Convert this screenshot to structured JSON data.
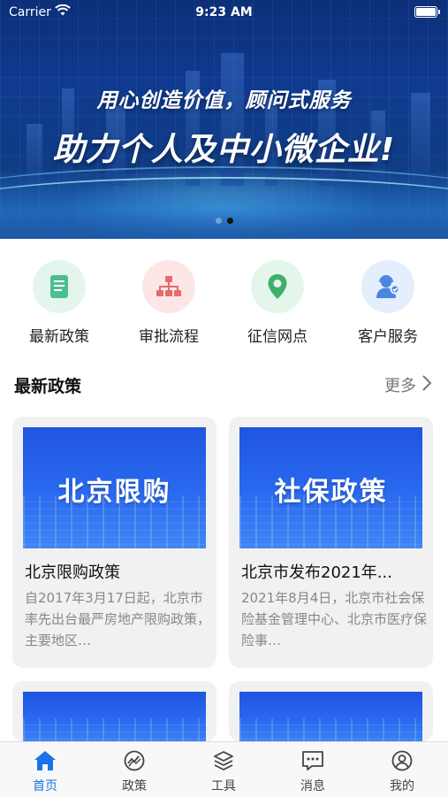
{
  "status_bar": {
    "carrier": "Carrier",
    "time": "9:23 AM"
  },
  "banner": {
    "line1": "用心创造价值，顾问式服务",
    "line2": "助力个人及中小微企业!",
    "page_count": 2,
    "active_page": 2
  },
  "quick_actions": [
    {
      "label": "最新政策",
      "icon": "document-icon",
      "bg": "#e4f5ee",
      "fg": "#4bbf8f"
    },
    {
      "label": "审批流程",
      "icon": "org-chart-icon",
      "bg": "#fde6e6",
      "fg": "#e86a6a"
    },
    {
      "label": "征信网点",
      "icon": "location-pin-icon",
      "bg": "#e4f6ea",
      "fg": "#3fb06a"
    },
    {
      "label": "客户服务",
      "icon": "customer-service-icon",
      "bg": "#e4eefc",
      "fg": "#4a86e0"
    }
  ],
  "section": {
    "title": "最新政策",
    "more": "更多"
  },
  "cards": [
    {
      "image_caption": "北京限购",
      "title": "北京限购政策",
      "desc": "自2017年3月17日起，北京市率先出台最严房地产限购政策，主要地区…"
    },
    {
      "image_caption": "社保政策",
      "title": "北京市发布2021年...",
      "desc": "2021年8月4日，北京市社会保险基金管理中心、北京市医疗保险事…"
    },
    {
      "image_caption": "",
      "title": "",
      "desc": ""
    },
    {
      "image_caption": "",
      "title": "",
      "desc": ""
    }
  ],
  "tabs": [
    {
      "label": "首页",
      "icon": "home-icon",
      "active": true
    },
    {
      "label": "政策",
      "icon": "trend-icon",
      "active": false
    },
    {
      "label": "工具",
      "icon": "layers-icon",
      "active": false
    },
    {
      "label": "消息",
      "icon": "message-icon",
      "active": false
    },
    {
      "label": "我的",
      "icon": "profile-icon",
      "active": false
    }
  ],
  "colors": {
    "accent": "#1a73e8",
    "card_bg": "#f1f1f1",
    "banner": "#103a8f"
  }
}
